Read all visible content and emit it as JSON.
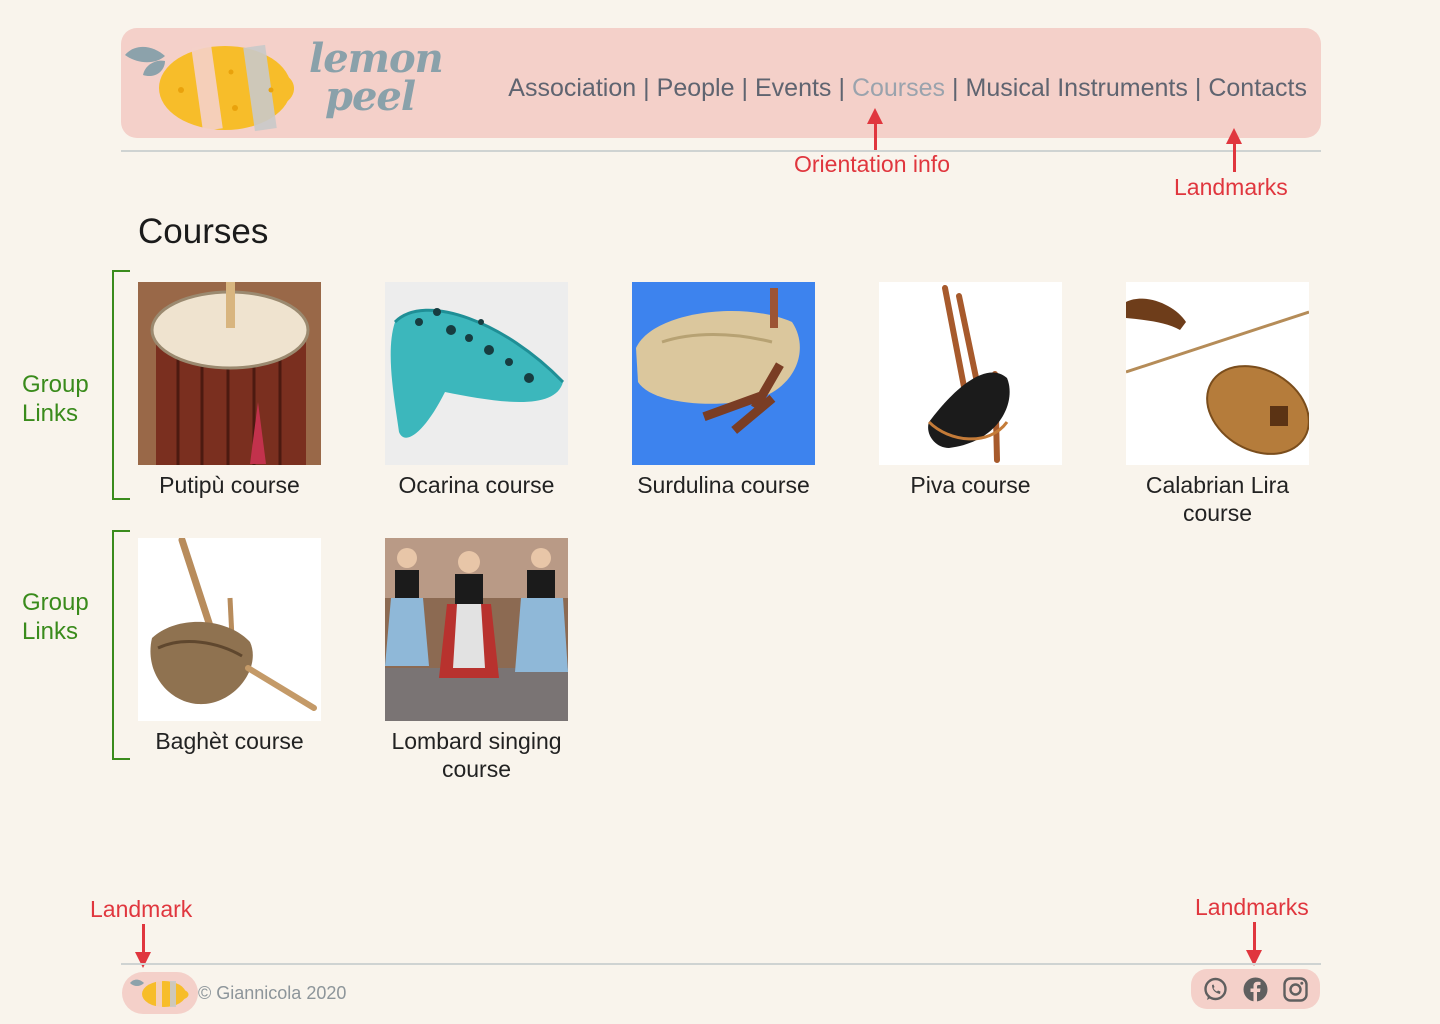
{
  "brand": {
    "logo_line1": "lemon",
    "logo_line2": "peel",
    "colors": {
      "header_bg": "#f4d0c9",
      "page_bg": "#f9f4ec",
      "logo_text": "#8aa1aa",
      "lemon": "#f7bd2a"
    }
  },
  "nav": {
    "separator": "|",
    "items": [
      {
        "label": "Association",
        "active": false
      },
      {
        "label": "People",
        "active": false
      },
      {
        "label": "Events",
        "active": false
      },
      {
        "label": "Courses",
        "active": true
      },
      {
        "label": "Musical Instruments",
        "active": false
      },
      {
        "label": "Contacts",
        "active": false
      }
    ]
  },
  "annotations": {
    "orientation_info": "Orientation info",
    "landmarks_header": "Landmarks",
    "landmark_footer_left": "Landmark",
    "landmarks_footer_right": "Landmarks",
    "group_links_1": [
      "Group",
      "Links"
    ],
    "group_links_2": [
      "Group",
      "Links"
    ],
    "colors": {
      "red": "#e0363e",
      "green": "#3a8b1c"
    }
  },
  "main": {
    "title": "Courses",
    "courses": [
      {
        "caption": "Putipù course",
        "image_icon": "putipu-drum-photo"
      },
      {
        "caption": "Ocarina course",
        "image_icon": "ocarina-photo"
      },
      {
        "caption": "Surdulina course",
        "image_icon": "surdulina-bagpipe-photo"
      },
      {
        "caption": "Piva course",
        "image_icon": "piva-bagpipe-photo"
      },
      {
        "caption": "Calabrian Lira course",
        "image_icon": "calabrian-lira-photo"
      },
      {
        "caption": "Baghèt course",
        "image_icon": "baghet-bagpipe-photo"
      },
      {
        "caption": "Lombard singing course",
        "image_icon": "lombard-singers-photo"
      }
    ]
  },
  "footer": {
    "copyright": "© Giannicola 2020",
    "social": [
      "whatsapp-icon",
      "facebook-icon",
      "instagram-icon"
    ]
  }
}
